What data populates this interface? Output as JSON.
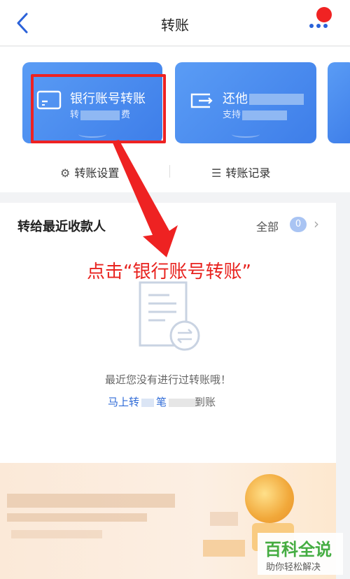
{
  "header": {
    "title": "转账",
    "back_icon": "chevron-left-icon",
    "more_icon": "more-dots-icon"
  },
  "cards": [
    {
      "title": "银行账号转账",
      "subtitle_start": "转",
      "subtitle_end": "费",
      "icon": "bank-card-icon"
    },
    {
      "title": "还他",
      "subtitle_start": "支持",
      "subtitle_end": "",
      "icon": "repay-card-icon"
    }
  ],
  "links": {
    "settings": "转账设置",
    "records": "转账记录"
  },
  "recent": {
    "title": "转给最近收款人",
    "all_label": "全部",
    "count": "0",
    "empty_text": "最近您没有进行过转账哦！",
    "cta_start": "马上转",
    "cta_mid": "笔",
    "cta_end": "到账"
  },
  "annotation": {
    "text": "点击“银行账号转账”"
  },
  "watermark": {
    "main": "百科全说",
    "sub": "助你轻松解决"
  },
  "colors": {
    "accent": "#3e7ee9",
    "highlight": "#ee2222",
    "link": "#2f6bd7"
  }
}
